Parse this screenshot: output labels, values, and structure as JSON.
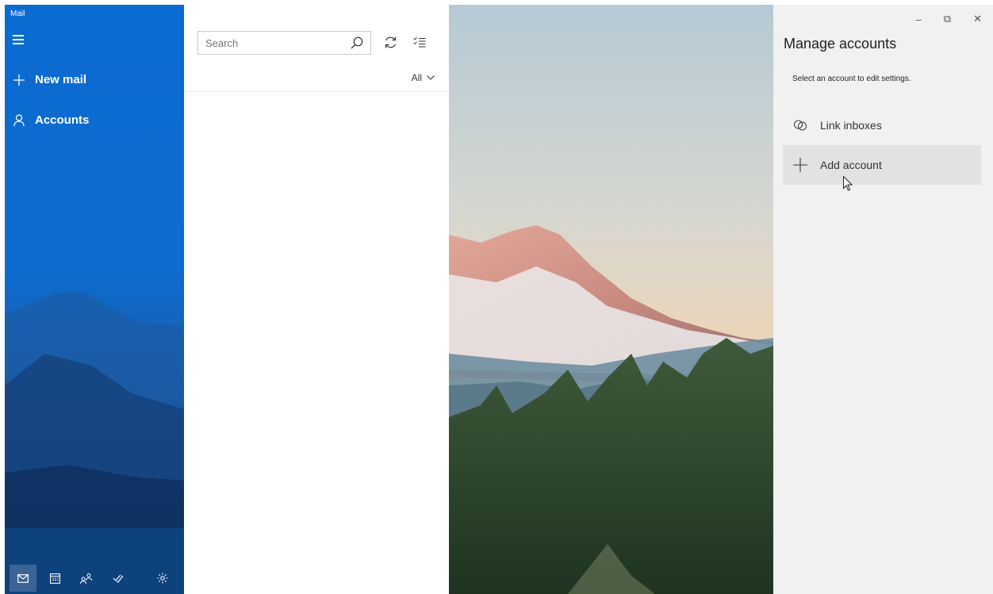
{
  "window": {
    "app_title": "Mail",
    "controls": {
      "minimize": "–",
      "restore": "⧉",
      "close": "✕"
    }
  },
  "nav": {
    "new_mail": "New mail",
    "accounts": "Accounts",
    "bottom_icons": [
      "mail-icon",
      "calendar-icon",
      "people-icon",
      "todo-icon",
      "settings-icon"
    ]
  },
  "list": {
    "search_placeholder": "Search",
    "filter_label": "All"
  },
  "flyout": {
    "title": "Manage accounts",
    "subtitle": "Select an account to edit settings.",
    "items": [
      {
        "label": "Link inboxes",
        "icon": "link-icon"
      },
      {
        "label": "Add account",
        "icon": "plus-icon"
      }
    ]
  },
  "colors": {
    "nav_accent": "#0a6bd1",
    "flyout_bg": "#f1f1f1",
    "hover_bg": "#e2e2e2"
  }
}
